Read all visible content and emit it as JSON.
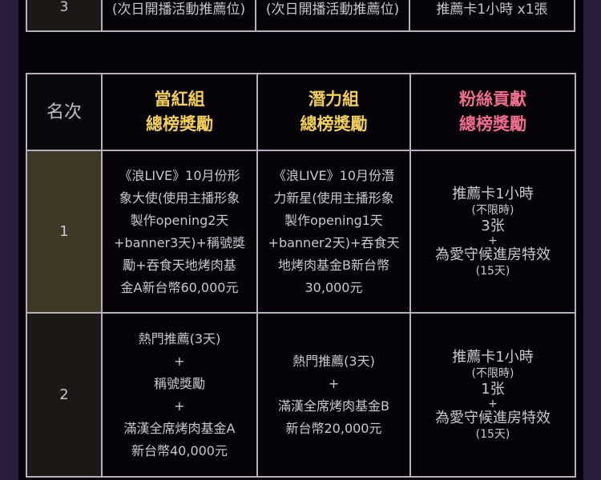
{
  "top_row": {
    "rank": "3",
    "col1": "(次日開播活動推薦位)",
    "col2": "(次日開播活動推薦位)",
    "col3": "推薦卡1小時 x1張"
  },
  "header": {
    "rank": "名次",
    "col1_line1": "當紅組",
    "col1_line2": "總榜獎勵",
    "col2_line1": "潛力組",
    "col2_line2": "總榜獎勵",
    "col3_line1": "粉絲貢獻",
    "col3_line2": "總榜獎勵"
  },
  "rows": [
    {
      "rank": "1",
      "col1": [
        "《浪LIVE》10月份形",
        "象大使(使用主播形象",
        "製作opening2天",
        "+banner3天)+稱號獎",
        "勵+吞食天地烤肉基",
        "金A新台幣60,000元"
      ],
      "col2": [
        "《浪LIVE》10月份潛",
        "力新星(使用主播形象",
        "製作opening1天",
        "+banner2天)+吞食天",
        "地烤肉基金B新台幣",
        "30,000元"
      ],
      "fans": {
        "card": "推薦卡1小時",
        "limit": "(不限時)",
        "count": "3张",
        "plus": "+",
        "effect": "為愛守候進房特效",
        "days": "(15天)"
      }
    },
    {
      "rank": "2",
      "col1": [
        "熱門推薦(3天)",
        "+",
        "稱號獎勵",
        "+",
        "滿漢全席烤肉基金A",
        "新台幣40,000元"
      ],
      "col2": [
        "熱門推薦(3天)",
        "+",
        "滿漢全席烤肉基金B",
        "新台幣20,000元"
      ],
      "fans": {
        "card": "推薦卡1小時",
        "limit": "(不限時)",
        "count": "1张",
        "plus": "+",
        "effect": "為愛守候進房特效",
        "days": "(15天)"
      }
    }
  ],
  "colors": {
    "gold": "#f1cf58",
    "pink": "#ef6e8e",
    "background": "#050307",
    "border": "#b7aec0"
  }
}
